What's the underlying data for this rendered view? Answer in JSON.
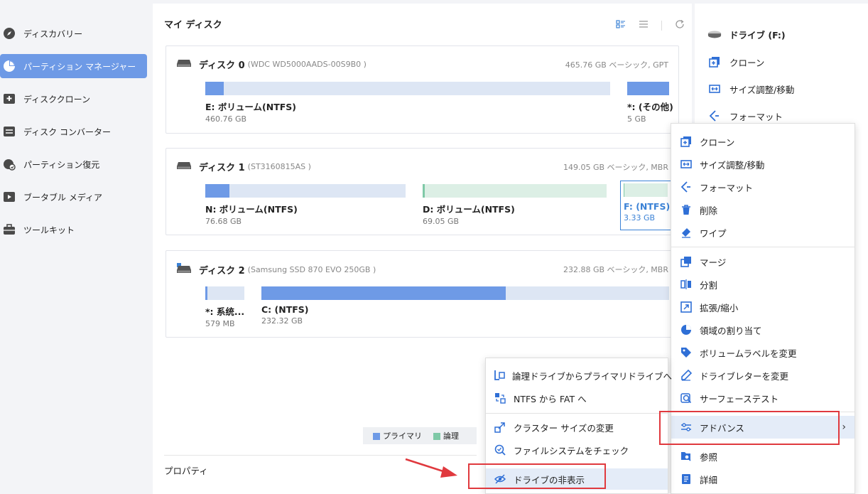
{
  "sidebar": {
    "items": [
      {
        "label": "ディスカバリー",
        "icon": "compass-icon"
      },
      {
        "label": "パーティション マネージャー",
        "icon": "pie-chart-icon",
        "active": true
      },
      {
        "label": "ディスククローン",
        "icon": "disk-clone-icon"
      },
      {
        "label": "ディスク コンバーター",
        "icon": "disk-converter-icon"
      },
      {
        "label": "パーティション復元",
        "icon": "partition-recovery-icon"
      },
      {
        "label": "ブータブル メディア",
        "icon": "bootable-media-icon"
      },
      {
        "label": "ツールキット",
        "icon": "toolkit-icon"
      }
    ]
  },
  "main": {
    "title": "マイ ディスク",
    "disks": [
      {
        "name": "ディスク 0",
        "model": "(WDC WD5000AADS-00S9B0 )",
        "info": "465.76 GB ベーシック, GPT",
        "partitions": [
          {
            "name": "E: ボリューム(NTFS)",
            "size": "460.76 GB",
            "used_fraction": 0.045,
            "type": "primary"
          },
          {
            "name": "*: (その他)",
            "size": "5 GB",
            "used_fraction": 1.0,
            "type": "primary"
          }
        ]
      },
      {
        "name": "ディスク 1",
        "model": "(ST3160815AS )",
        "info": "149.05 GB ベーシック, MBR",
        "partitions": [
          {
            "name": "N: ボリューム(NTFS)",
            "size": "76.68 GB",
            "used_fraction": 0.12,
            "type": "primary"
          },
          {
            "name": "D: ボリューム(NTFS)",
            "size": "69.05 GB",
            "used_fraction": 0.01,
            "type": "logical"
          },
          {
            "name": "F: (NTFS)",
            "size": "3.33 GB",
            "used_fraction": 0.02,
            "type": "logical",
            "selected": true
          }
        ]
      },
      {
        "name": "ディスク 2",
        "model": "(Samsung SSD 870 EVO 250GB )",
        "info": "232.88 GB ベーシック, MBR",
        "partitions": [
          {
            "name": "*: 系统...",
            "size": "579 MB",
            "used_fraction": 0.05,
            "type": "primary"
          },
          {
            "name": "C: (NTFS)",
            "size": "232.32 GB",
            "used_fraction": 0.6,
            "type": "primary"
          }
        ]
      }
    ],
    "legend": {
      "primary": "プライマリ",
      "logical": "論理"
    },
    "properties_title": "プロパティ"
  },
  "right_panel": {
    "drive_label": "ドライブ (F:)",
    "items": [
      {
        "label": "クローン",
        "icon": "clone-icon"
      },
      {
        "label": "サイズ調整/移動",
        "icon": "resize-icon"
      },
      {
        "label": "フォーマット",
        "icon": "format-icon"
      }
    ]
  },
  "context_menu": {
    "items": [
      {
        "label": "クローン",
        "icon": "clone-icon"
      },
      {
        "label": "サイズ調整/移動",
        "icon": "resize-icon"
      },
      {
        "label": "フォーマット",
        "icon": "format-icon"
      },
      {
        "label": "削除",
        "icon": "trash-icon"
      },
      {
        "label": "ワイプ",
        "icon": "eraser-icon"
      },
      {
        "label": "マージ",
        "icon": "merge-icon"
      },
      {
        "label": "分割",
        "icon": "split-icon"
      },
      {
        "label": "拡張/縮小",
        "icon": "extend-shrink-icon"
      },
      {
        "label": "領域の割り当て",
        "icon": "allocate-icon"
      },
      {
        "label": "ボリュームラベルを変更",
        "icon": "label-tag-icon"
      },
      {
        "label": "ドライブレターを変更",
        "icon": "pencil-icon"
      },
      {
        "label": "サーフェーステスト",
        "icon": "surface-test-icon"
      },
      {
        "label": "アドバンス",
        "icon": "sliders-icon"
      },
      {
        "label": "参照",
        "icon": "browse-icon"
      },
      {
        "label": "詳細",
        "icon": "details-icon"
      }
    ],
    "submenu": [
      {
        "label": "論理ドライブからプライマリドライブへ",
        "icon": "logical-to-primary-icon"
      },
      {
        "label": "NTFS から FAT へ",
        "icon": "ntfs-to-fat-icon"
      },
      {
        "label": "クラスター サイズの変更",
        "icon": "cluster-size-icon"
      },
      {
        "label": "ファイルシステムをチェック",
        "icon": "check-filesystem-icon"
      },
      {
        "label": "ドライブの非表示",
        "icon": "hide-drive-icon"
      }
    ]
  },
  "colors": {
    "accent": "#6e9ae6",
    "logical": "#7fc9a7",
    "highlight": "#e0393e",
    "menu_icon": "#2f6fd6"
  }
}
